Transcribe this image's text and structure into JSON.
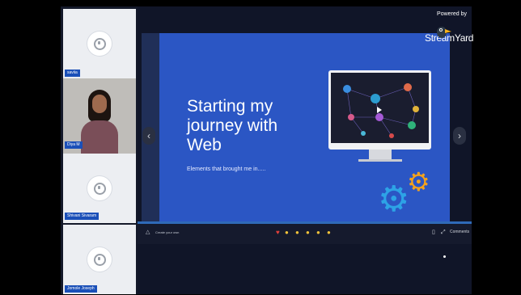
{
  "branding": {
    "powered_by": "Powered by",
    "logo_text": "StreamYard"
  },
  "participants": [
    {
      "name": "saviia",
      "video": false
    },
    {
      "name": "Diya M",
      "video": true
    },
    {
      "name": "Shivani Sivaram",
      "video": false
    },
    {
      "name": "Jomole Joseph",
      "video": false
    }
  ],
  "slide": {
    "title": "Starting my\njourney with\nWeb",
    "subtitle": "Elements that brought me in....."
  },
  "toolbar": {
    "create_label": "Create your own",
    "comments_label": "Comments",
    "reactions": [
      "heart",
      "thumbs-up",
      "clap",
      "laughing",
      "surprised",
      "sad"
    ]
  },
  "colors": {
    "slide_bg": "#2b56c4",
    "name_tag": "#1a4fb8",
    "gear_orange": "#f3a21c",
    "gear_blue": "#2da3e6"
  }
}
